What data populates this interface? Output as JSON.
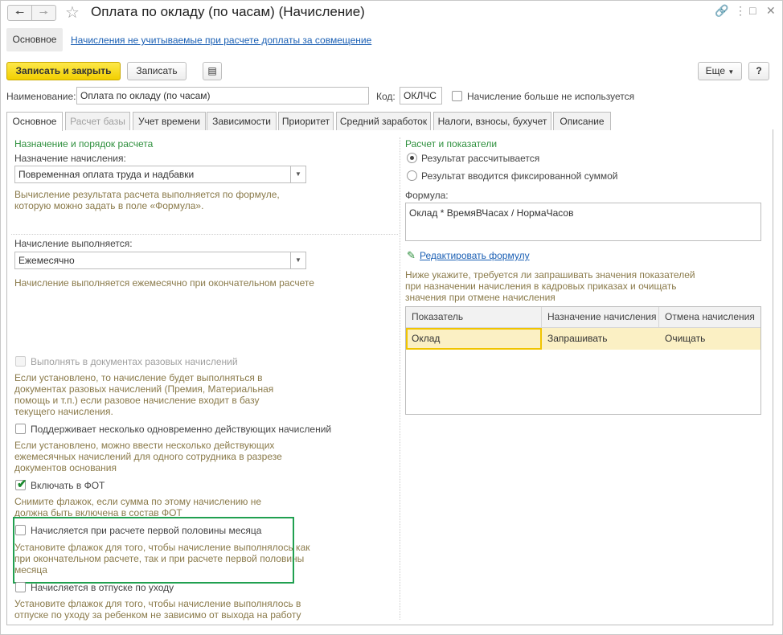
{
  "window": {
    "title": "Оплата по окладу (по часам) (Начисление)",
    "icons": [
      "back-icon",
      "forward-icon",
      "star-icon",
      "link-icon",
      "more-icon",
      "maximize-icon",
      "close-icon"
    ]
  },
  "sections": {
    "main_label": "Основное",
    "link_label": "Начисления не учитываемые при расчете доплаты за совмещение"
  },
  "toolbar": {
    "save_close": "Записать и закрыть",
    "save": "Записать",
    "more": "Еще",
    "help": "?"
  },
  "header": {
    "name_label": "Наименование:",
    "name_value": "Оплата по окладу (по часам)",
    "code_label": "Код:",
    "code_value": "ОКЛЧС",
    "unused_label": "Начисление больше не используется"
  },
  "tabs": [
    {
      "label": "Основное",
      "active": true
    },
    {
      "label": "Расчет базы",
      "disabled": true
    },
    {
      "label": "Учет времени"
    },
    {
      "label": "Зависимости"
    },
    {
      "label": "Приоритет"
    },
    {
      "label": "Средний заработок"
    },
    {
      "label": "Налоги, взносы, бухучет"
    },
    {
      "label": "Описание"
    }
  ],
  "left": {
    "group_title": "Назначение и порядок расчета",
    "purpose_label": "Назначение начисления:",
    "purpose_value": "Повременная оплата труда и надбавки",
    "purpose_hint_1": "Вычисление результата расчета выполняется по формуле,",
    "purpose_hint_2": "которую можно задать в поле «Формула».",
    "period_label": "Начисление выполняется:",
    "period_value": "Ежемесячно",
    "period_hint": "Начисление выполняется ежемесячно при окончательном расчете",
    "one_time_label": "Выполнять в документах разовых начислений",
    "one_time_hint": [
      "Если установлено, то начисление будет выполняться в",
      "документах разовых начислений (Премия, Материальная",
      "помощь и т.п.) если разовое начисление входит в базу",
      "текущего начисления."
    ],
    "multiple_label": "Поддерживает несколько одновременно действующих начислений",
    "multiple_hint": [
      "Если установлено, можно ввести несколько действующих",
      "ежемесячных начислений для одного сотрудника в разрезе",
      "документов основания"
    ],
    "fot_label": "Включать в ФОТ",
    "fot_hint": [
      "Снимите флажок, если сумма по этому начислению не",
      "должна быть включена в состав ФОТ"
    ],
    "first_half_label": "Начисляется при расчете первой половины месяца",
    "first_half_hint": [
      "Установите флажок для того, чтобы начисление выполнялось как",
      "при окончательном расчете, так и при расчете первой половины",
      "месяца"
    ],
    "leave_label": "Начисляется в отпуске по уходу",
    "leave_hint": [
      "Установите флажок для того, чтобы начисление выполнялось в",
      "отпуске по уходу за ребенком не зависимо от выхода на работу"
    ]
  },
  "right": {
    "group_title": "Расчет и показатели",
    "radio_calc": "Результат рассчитывается",
    "radio_fixed": "Результат вводится фиксированной суммой",
    "formula_label": "Формула:",
    "formula_value": "Оклад * ВремяВЧасах / НормаЧасов",
    "edit_formula": "Редактировать формулу",
    "indicators_hint": [
      "Ниже укажите, требуется ли запрашивать значения показателей",
      "при назначении начисления в кадровых приказах и очищать",
      "значения при отмене начисления"
    ],
    "table": {
      "columns": [
        "Показатель",
        "Назначение начисления",
        "Отмена начисления"
      ],
      "rows": [
        [
          "Оклад",
          "Запрашивать",
          "Очищать"
        ]
      ]
    }
  },
  "colors": {
    "primary_button": "#f2cf00",
    "group_title": "#2d8f3c",
    "hint_text": "#8a7a4a",
    "highlight_frame": "#20a050",
    "selected_row": "#fbf0c4"
  }
}
